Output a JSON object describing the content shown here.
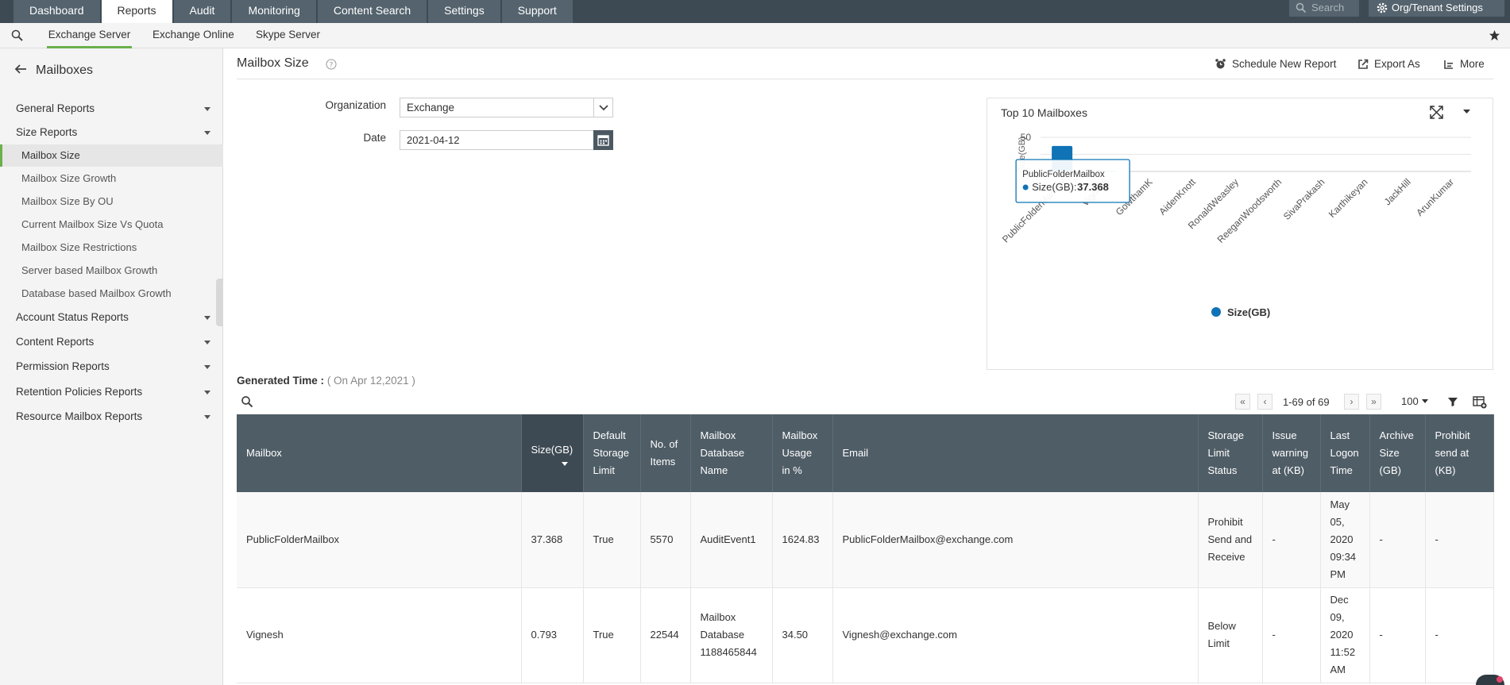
{
  "topnav": {
    "tabs": [
      {
        "label": "Dashboard",
        "active": false
      },
      {
        "label": "Reports",
        "active": true
      },
      {
        "label": "Audit",
        "active": false
      },
      {
        "label": "Monitoring",
        "active": false
      },
      {
        "label": "Content Search",
        "active": false
      },
      {
        "label": "Settings",
        "active": false
      },
      {
        "label": "Support",
        "active": false
      }
    ],
    "search_placeholder": "Search",
    "org_settings_label": "Org/Tenant Settings"
  },
  "subnav": {
    "tabs": [
      {
        "label": "Exchange Server",
        "active": true
      },
      {
        "label": "Exchange Online",
        "active": false
      },
      {
        "label": "Skype Server",
        "active": false
      }
    ]
  },
  "sidebar": {
    "title": "Mailboxes",
    "sections": [
      {
        "label": "General Reports"
      },
      {
        "label": "Size Reports"
      },
      {
        "label": "Account Status Reports"
      },
      {
        "label": "Content Reports"
      },
      {
        "label": "Permission Reports"
      },
      {
        "label": "Retention Policies Reports"
      },
      {
        "label": "Resource Mailbox Reports"
      }
    ],
    "size_reports_items": [
      {
        "label": "Mailbox Size",
        "active": true
      },
      {
        "label": "Mailbox Size Growth"
      },
      {
        "label": "Mailbox Size By OU"
      },
      {
        "label": "Current Mailbox Size Vs Quota"
      },
      {
        "label": "Mailbox Size Restrictions"
      },
      {
        "label": "Server based Mailbox Growth"
      },
      {
        "label": "Database based Mailbox Growth"
      }
    ]
  },
  "page": {
    "title": "Mailbox Size",
    "actions": {
      "schedule": "Schedule New Report",
      "export": "Export As",
      "more": "More"
    }
  },
  "form": {
    "organization_label": "Organization",
    "organization_value": "Exchange",
    "date_label": "Date",
    "date_value": "2021-04-12"
  },
  "chart_data": {
    "type": "bar",
    "title": "Top 10 Mailboxes",
    "ylabel": "Size(GB)",
    "ylim": [
      0,
      50
    ],
    "yticks": [
      "50",
      "0"
    ],
    "categories": [
      "PublicFolderMailbox",
      "Vignesh",
      "GowthamK",
      "AidenKnott",
      "RonaldWeasley",
      "ReeganWoodsworth",
      "SivaPrakash",
      "Karthikeyan",
      "JackHill",
      "ArunKumar"
    ],
    "series": [
      {
        "name": "Size(GB)",
        "values": [
          37.368,
          0.793,
          0,
          0,
          0,
          0,
          0,
          0,
          0,
          0
        ]
      }
    ],
    "legend": "bottom-center",
    "tooltip": {
      "category": "PublicFolderMailbox",
      "series": "Size(GB)",
      "value": "37.368"
    },
    "color": "#0f73b5"
  },
  "report": {
    "generated_label": "Generated Time :",
    "generated_value": "( On Apr 12,2021 )",
    "pager_text": "1-69 of 69",
    "per_page": "100"
  },
  "table": {
    "columns": [
      "Mailbox",
      "Size(GB)",
      "Default Storage Limit",
      "No. of Items",
      "Mailbox Database Name",
      "Mailbox Usage in %",
      "Email",
      "Storage Limit Status",
      "Issue warning at (KB)",
      "Last Logon Time",
      "Archive Size (GB)",
      "Prohibit send at (KB)"
    ],
    "rows": [
      [
        "PublicFolderMailbox",
        "37.368",
        "True",
        "5570",
        "AuditEvent1",
        "1624.83",
        "PublicFolderMailbox@exchange.com",
        "Prohibit Send and Receive",
        "-",
        "May 05, 2020 09:34 PM",
        "-",
        "-"
      ],
      [
        "Vignesh",
        "0.793",
        "True",
        "22544",
        "Mailbox Database 1188465844",
        "34.50",
        "Vignesh@exchange.com",
        "Below Limit",
        "-",
        "Dec 09, 2020 11:52 AM",
        "-",
        "-"
      ]
    ]
  }
}
